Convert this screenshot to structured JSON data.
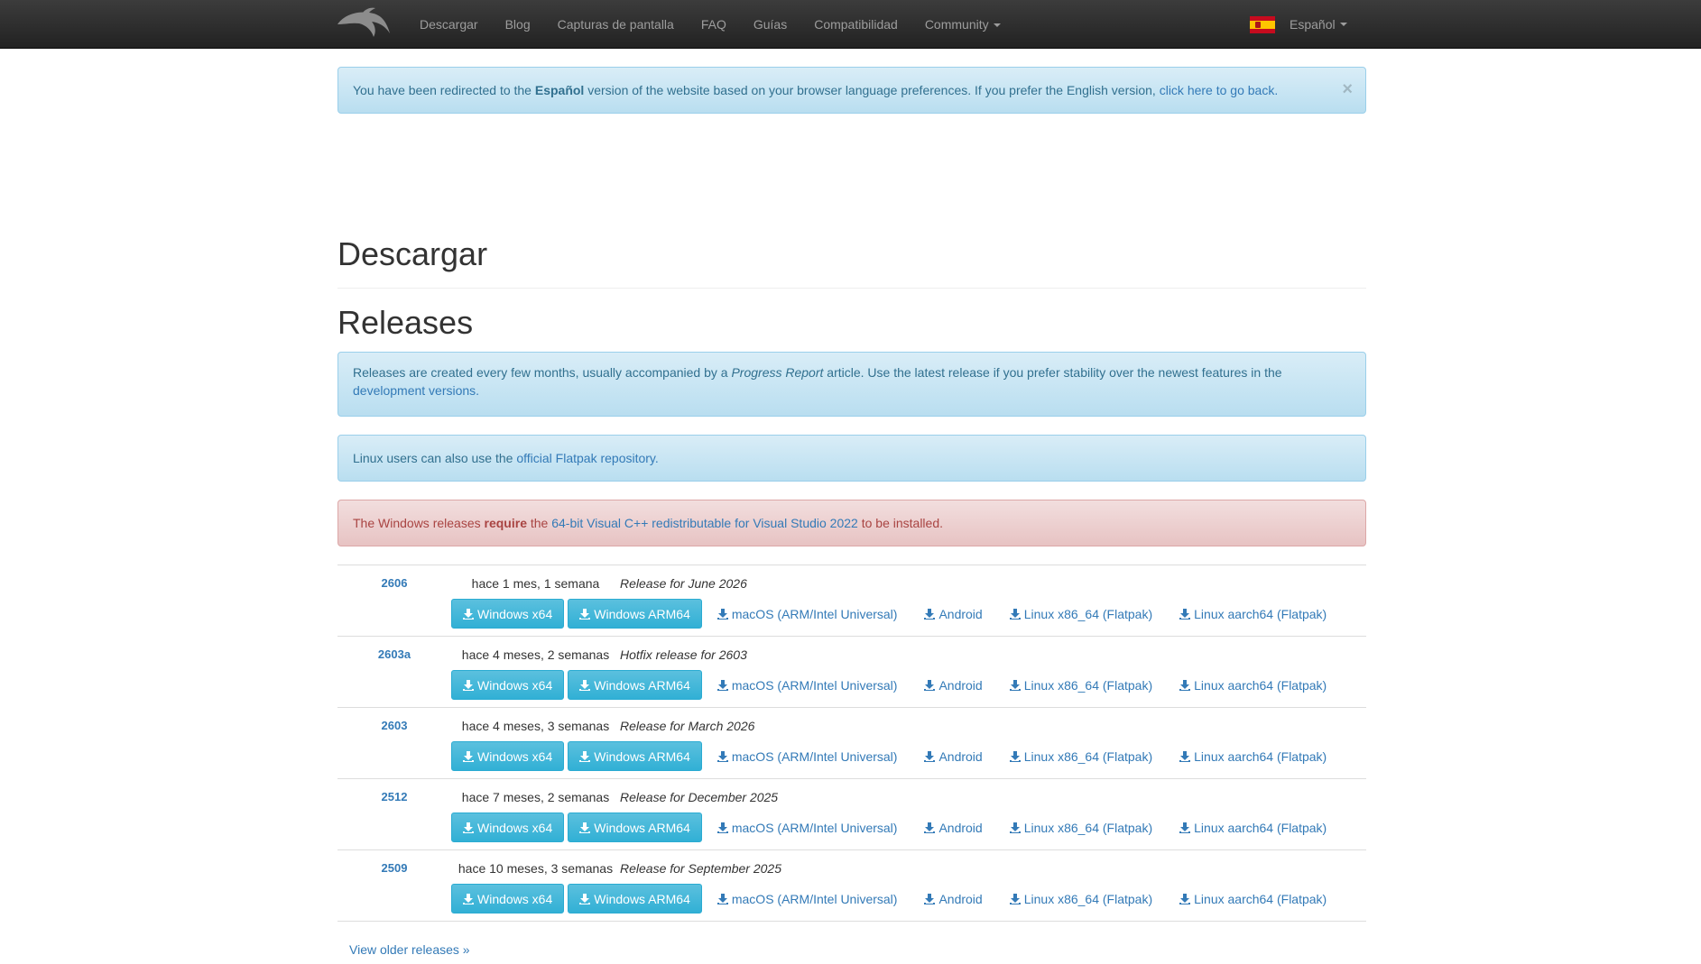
{
  "navbar": {
    "items": [
      "Descargar",
      "Blog",
      "Capturas de pantalla",
      "FAQ",
      "Guías",
      "Compatibilidad",
      "Community"
    ],
    "language": "Español"
  },
  "redirect_alert": {
    "pre": "You have been redirected to the ",
    "lang": "Español",
    "mid": " version of the website based on your browser language preferences. If you prefer the English version, ",
    "link": "click here to go back.",
    "close": "×"
  },
  "page": {
    "title": "Descargar",
    "section": "Releases"
  },
  "releases_alert": {
    "pre": "Releases are created every few months, usually accompanied by a ",
    "em": "Progress Report",
    "mid": " article. Use the latest release if you prefer stability over the newest features in the ",
    "link": "development versions."
  },
  "flatpak_alert": {
    "pre": "Linux users can also use the ",
    "link": "official Flatpak repository."
  },
  "windows_alert": {
    "pre": "The Windows releases ",
    "strong": "require",
    "mid": " the ",
    "link": "64-bit Visual C++ redistributable for Visual Studio 2022",
    "post": " to be installed."
  },
  "download_labels": {
    "win_x64": "Windows x64",
    "win_arm64": "Windows ARM64",
    "macos": "macOS (ARM/Intel Universal)",
    "android": "Android",
    "linux_x86": "Linux x86_64 (Flatpak)",
    "linux_arm": "Linux aarch64 (Flatpak)"
  },
  "releases": [
    {
      "version": "2606",
      "date": "hace 1 mes, 1 semana",
      "description": "Release for June 2026"
    },
    {
      "version": "2603a",
      "date": "hace 4 meses, 2 semanas",
      "description": "Hotfix release for 2603"
    },
    {
      "version": "2603",
      "date": "hace 4 meses, 3 semanas",
      "description": "Release for March 2026"
    },
    {
      "version": "2512",
      "date": "hace 7 meses, 2 semanas",
      "description": "Release for December 2025"
    },
    {
      "version": "2509",
      "date": "hace 10 meses, 3 semanas",
      "description": "Release for September 2025"
    }
  ],
  "older_link": "View older releases »",
  "colors": {
    "navbar": "#222222",
    "link": "#337ab7",
    "info_button": "#5bc0de",
    "info_text": "#31708f",
    "danger_text": "#a94442"
  }
}
